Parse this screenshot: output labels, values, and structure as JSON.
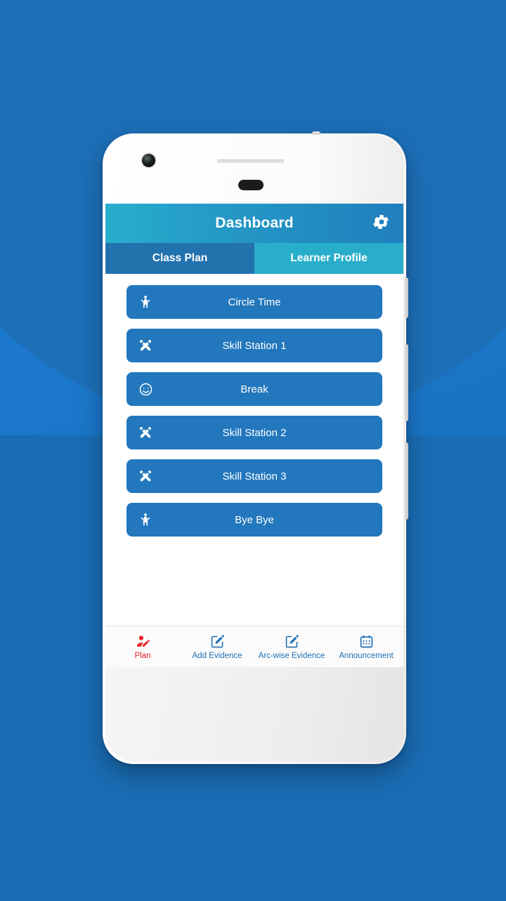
{
  "theme": {
    "background_blue": "#1b76c8",
    "background_circle": "#1d6fb8",
    "appbar_gradient_start": "#29aecf",
    "appbar_gradient_end": "#1f7fbd",
    "tab_active_bg": "#2272ae",
    "tab_inactive_bg": "#28aecb",
    "button_blue": "#2277bd",
    "nav_active_red": "#e8222a",
    "nav_idle_blue": "#1f6fb3"
  },
  "appbar": {
    "title": "Dashboard",
    "settings_icon": "gear-icon"
  },
  "tabs": [
    {
      "label": "Class Plan",
      "active": true
    },
    {
      "label": "Learner Profile",
      "active": false
    }
  ],
  "plan_items": [
    {
      "label": "Circle Time",
      "icon": "child-raised-arms-icon"
    },
    {
      "label": "Skill Station 1",
      "icon": "pencil-ruler-icon"
    },
    {
      "label": "Break",
      "icon": "smiley-face-icon"
    },
    {
      "label": "Skill Station 2",
      "icon": "pencil-ruler-icon"
    },
    {
      "label": "Skill Station 3",
      "icon": "pencil-ruler-icon"
    },
    {
      "label": "Bye Bye",
      "icon": "child-raised-arms-icon"
    }
  ],
  "bottom_nav": [
    {
      "label": "Plan",
      "icon": "user-edit-icon",
      "active": true
    },
    {
      "label": "Add Evidence",
      "icon": "note-pencil-icon",
      "active": false
    },
    {
      "label": "Arc-wise Evidence",
      "icon": "note-pencil-icon",
      "active": false
    },
    {
      "label": "Announcement",
      "icon": "calendar-icon",
      "active": false
    }
  ]
}
